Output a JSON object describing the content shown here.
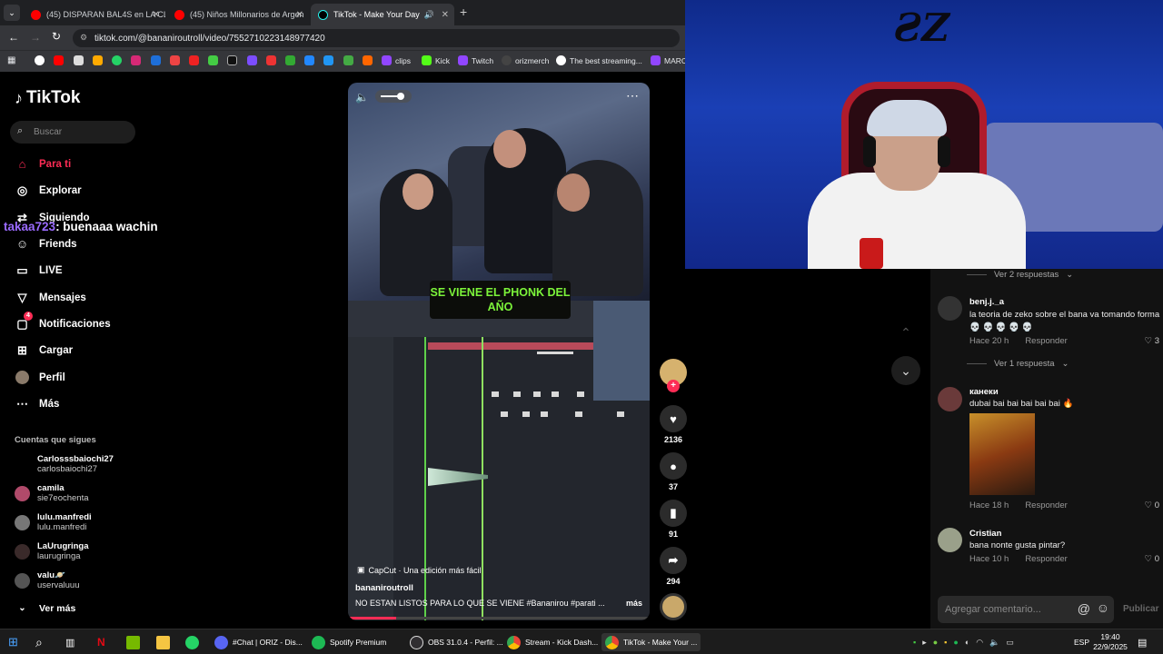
{
  "browser": {
    "tabs": [
      {
        "label": "(45) DISPARAN BAL4S en LA CL",
        "active": false
      },
      {
        "label": "(45) Niños Millonarios de Argen",
        "active": false
      },
      {
        "label": "TikTok - Make Your Day",
        "active": true
      }
    ],
    "url": "tiktok.com/@bananiroutroll/video/7552710223148977420",
    "bookmarks": [
      "clips",
      "Kick",
      "Twitch",
      "orizmerch",
      "The best streaming...",
      "MARCC"
    ]
  },
  "tiktok": {
    "logo": "TikTok",
    "search_placeholder": "Buscar",
    "nav": [
      {
        "label": "Para ti",
        "icon": "home-icon",
        "active": true
      },
      {
        "label": "Explorar",
        "icon": "compass-icon"
      },
      {
        "label": "Siguiendo",
        "icon": "following-icon"
      },
      {
        "label": "Friends",
        "icon": "friends-icon"
      },
      {
        "label": "LIVE",
        "icon": "live-icon"
      },
      {
        "label": "Mensajes",
        "icon": "messages-icon"
      },
      {
        "label": "Notificaciones",
        "icon": "notifications-icon",
        "badge": "4"
      },
      {
        "label": "Cargar",
        "icon": "upload-icon"
      },
      {
        "label": "Perfil",
        "icon": "profile-icon"
      },
      {
        "label": "Más",
        "icon": "more-icon"
      }
    ],
    "following_title": "Cuentas que sigues",
    "following": [
      {
        "name": "Carlosssbaiochi27",
        "handle": "carlosbaiochi27"
      },
      {
        "name": "camila",
        "handle": "sie7eochenta"
      },
      {
        "name": "lulu.manfredi",
        "handle": "lulu.manfredi"
      },
      {
        "name": "LaUrugringa",
        "handle": "laurugringa"
      },
      {
        "name": "valu🪐",
        "handle": "uservaluuu"
      }
    ],
    "see_more": "Ver más",
    "video": {
      "overlay_caption": "SE VIENE EL PHONK DEL AÑO",
      "capcut": "CapCut · Una edición más fácil",
      "author": "bananiroutroll",
      "description": "NO ESTAN LISTOS PARA LO QUE SE VIENE #Bananirou #parati ...",
      "more": "más",
      "likes": "2136",
      "comments": "37",
      "saves": "91",
      "shares": "294"
    }
  },
  "stream_chat": {
    "user": "takaa723",
    "message": ": buenaaa wachin"
  },
  "comments_panel": {
    "items": [
      {
        "type": "replies",
        "label": "Ver 2 respuestas"
      },
      {
        "type": "comment",
        "user": "benj.j._a",
        "text": "la teoria de zeko sobre el bana va tomando forma 💀 💀 💀 💀 💀",
        "time": "Hace 20 h",
        "reply": "Responder",
        "likes": "3"
      },
      {
        "type": "replies",
        "label": "Ver 1 respuesta"
      },
      {
        "type": "comment",
        "user": "канеки",
        "text": "dubai bai bai bai bai bai 🔥",
        "time": "Hace 18 h",
        "reply": "Responder",
        "likes": "0"
      },
      {
        "type": "comment",
        "user": "Cristian",
        "text": "bana nonte gusta pintar?",
        "time": "Hace 10 h",
        "reply": "Responder",
        "likes": "0"
      }
    ],
    "input_placeholder": "Agregar comentario...",
    "publish": "Publicar"
  },
  "taskbar": {
    "apps": [
      "#Chat | ORIZ - Dis...",
      "Spotify Premium",
      "OBS 31.0.4 - Perfil: ...",
      "Stream - Kick Dash...",
      "TikTok - Make Your ..."
    ],
    "lang": "ESP",
    "time": "19:40",
    "date": "22/9/2025"
  },
  "colors": {
    "tiktok_red": "#fe2c55",
    "caption_green": "#7cf43a",
    "webcam_blue": "#1a3fb5"
  }
}
